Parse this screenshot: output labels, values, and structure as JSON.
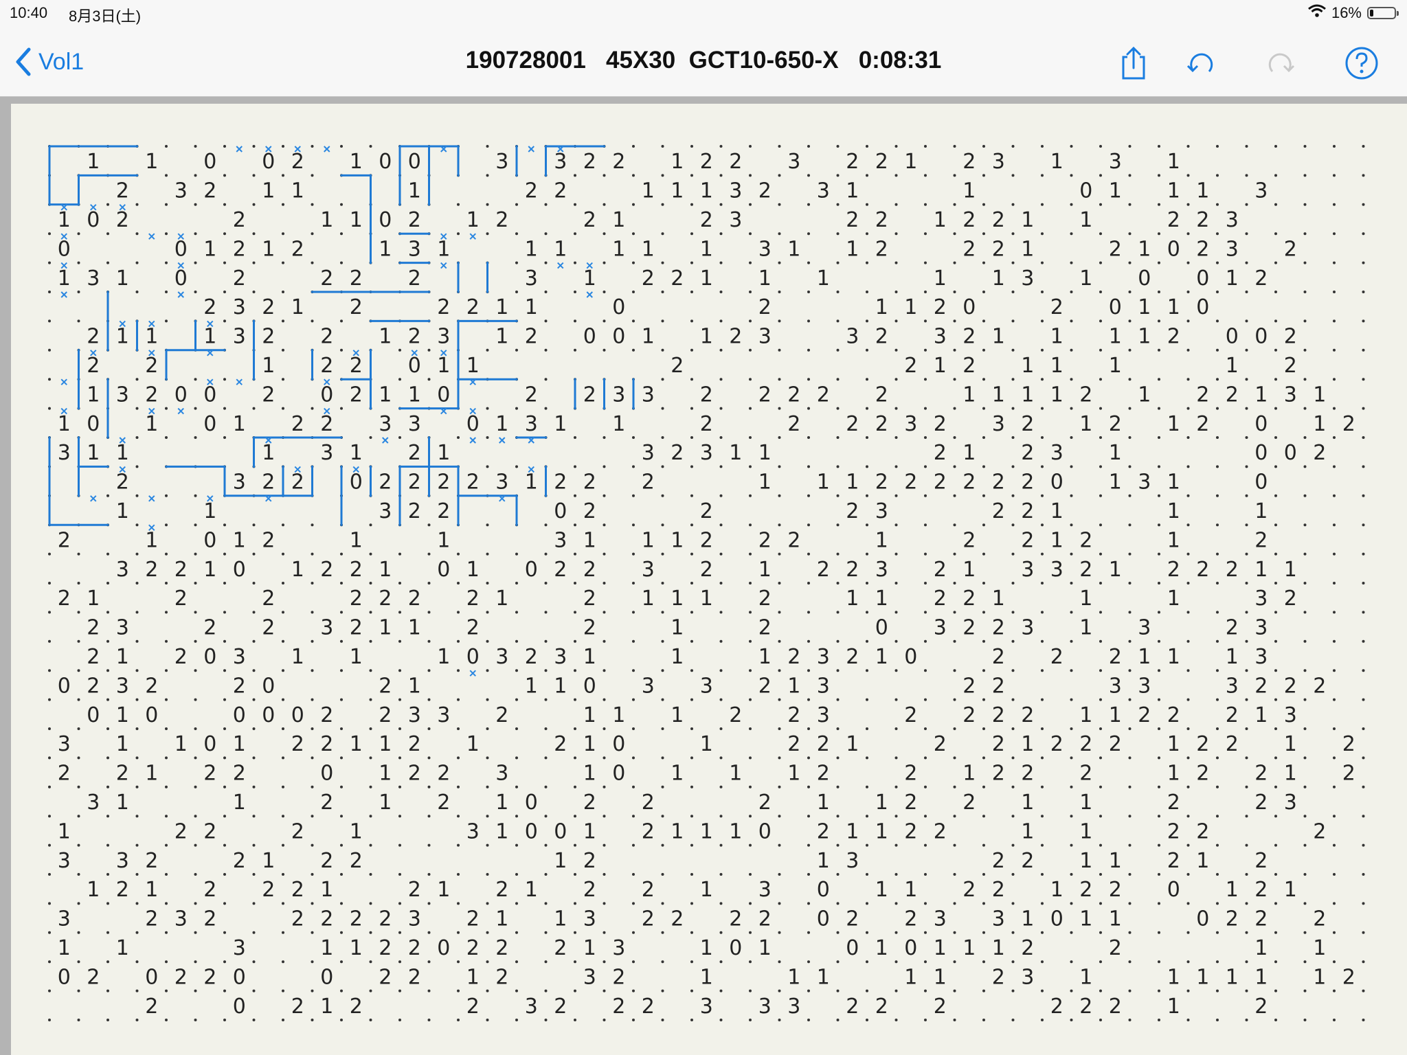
{
  "status_bar": {
    "time": "10:40",
    "date": "8月3日(土)",
    "battery": "16%",
    "battery_level": 0.16
  },
  "nav": {
    "back_label": "Vol1",
    "title": "190728001   45X30  GCT10-650-X   0:08:31",
    "icons": [
      "share-icon",
      "undo-icon",
      "redo-icon",
      "help-icon"
    ]
  },
  "colors": {
    "accent": "#1a7de0",
    "line": "#1f7ad4",
    "board_bg": "#f2f2ea",
    "frame": "#b4b4b4"
  },
  "puzzle": {
    "cols": 45,
    "rows": 30,
    "clues": [
      [
        " ",
        "1",
        " ",
        "1",
        " ",
        "0",
        " ",
        "0",
        "2",
        " ",
        "1",
        "0",
        "0",
        " ",
        " ",
        "3",
        " ",
        "3",
        "2",
        "2",
        " ",
        "1",
        "2",
        "2",
        " ",
        "3",
        " ",
        "2",
        "2",
        "1",
        " ",
        "2",
        "3",
        " ",
        "1",
        " ",
        "3",
        " ",
        "1",
        " ",
        " ",
        " ",
        " ",
        " ",
        " "
      ],
      [
        " ",
        " ",
        "2",
        " ",
        "3",
        "2",
        " ",
        "1",
        "1",
        " ",
        " ",
        " ",
        "1",
        " ",
        " ",
        " ",
        "2",
        "2",
        " ",
        " ",
        "1",
        "1",
        "1",
        "3",
        "2",
        " ",
        "3",
        "1",
        " ",
        " ",
        " ",
        "1",
        " ",
        " ",
        " ",
        "0",
        "1",
        " ",
        "1",
        "1",
        " ",
        "3",
        " ",
        " "
      ],
      [
        "1",
        "0",
        "2",
        " ",
        " ",
        " ",
        "2",
        " ",
        " ",
        "1",
        "1",
        "0",
        "2",
        " ",
        "1",
        "2",
        " ",
        " ",
        "2",
        "1",
        " ",
        " ",
        "2",
        "3",
        " ",
        " ",
        " ",
        "2",
        "2",
        " ",
        "1",
        "2",
        "2",
        "1",
        " ",
        "1",
        " ",
        " ",
        "2",
        "2",
        "3",
        " ",
        " ",
        " "
      ],
      [
        "0",
        " ",
        " ",
        " ",
        "0",
        "1",
        "2",
        "1",
        "2",
        " ",
        " ",
        "1",
        "3",
        "1",
        " ",
        " ",
        "1",
        "1",
        " ",
        "1",
        "1",
        " ",
        "1",
        " ",
        "3",
        "1",
        " ",
        "1",
        "2",
        " ",
        " ",
        "2",
        "2",
        "1",
        " ",
        " ",
        "2",
        "1",
        "0",
        "2",
        "3",
        " ",
        "2"
      ],
      [
        "1",
        "3",
        "1",
        " ",
        "0",
        " ",
        "2",
        " ",
        " ",
        "2",
        "2",
        " ",
        "2",
        " ",
        " ",
        " ",
        "3",
        " ",
        "1",
        " ",
        "2",
        "2",
        "1",
        " ",
        "1",
        " ",
        "1",
        " ",
        " ",
        " ",
        "1",
        " ",
        "1",
        "3",
        " ",
        "1",
        " ",
        "0",
        " ",
        "0",
        "1",
        "2",
        " "
      ],
      [
        " ",
        " ",
        " ",
        " ",
        " ",
        "2",
        "3",
        "2",
        "1",
        " ",
        "2",
        " ",
        " ",
        "2",
        "2",
        "1",
        "1",
        " ",
        " ",
        "0",
        " ",
        " ",
        " ",
        " ",
        "2",
        " ",
        " ",
        " ",
        "1",
        "1",
        "2",
        "0",
        " ",
        " ",
        "2",
        " ",
        "0",
        "1",
        "1",
        "0",
        " ",
        " ",
        " "
      ],
      [
        " ",
        "2",
        "1",
        "1",
        " ",
        "1",
        "3",
        "2",
        " ",
        "2",
        " ",
        "1",
        "2",
        "3",
        " ",
        "1",
        "2",
        " ",
        "0",
        "0",
        "1",
        " ",
        "1",
        "2",
        "3",
        " ",
        " ",
        "3",
        "2",
        " ",
        "3",
        "2",
        "1",
        " ",
        "1",
        " ",
        "1",
        "1",
        "2",
        " ",
        "0",
        "0",
        "2"
      ],
      [
        " ",
        "2",
        " ",
        "2",
        " ",
        " ",
        " ",
        "1",
        " ",
        "2",
        "2",
        " ",
        "0",
        "1",
        "1",
        " ",
        " ",
        " ",
        " ",
        " ",
        " ",
        "2",
        " ",
        " ",
        " ",
        " ",
        " ",
        " ",
        " ",
        "2",
        "1",
        "2",
        " ",
        "1",
        "1",
        " ",
        "1",
        " ",
        " ",
        " ",
        "1",
        " ",
        "2"
      ],
      [
        " ",
        "1",
        "3",
        "2",
        "0",
        "0",
        " ",
        "2",
        " ",
        "0",
        "2",
        "1",
        "1",
        "0",
        " ",
        " ",
        "2",
        " ",
        "2",
        "3",
        "3",
        " ",
        "2",
        " ",
        "2",
        "2",
        "2",
        " ",
        "2",
        " ",
        " ",
        "1",
        "1",
        "1",
        "1",
        "2",
        " ",
        "1",
        " ",
        "2",
        "2",
        "1",
        "3",
        "1"
      ],
      [
        "1",
        "0",
        " ",
        "1",
        " ",
        "0",
        "1",
        " ",
        "2",
        "2",
        " ",
        "3",
        "3",
        " ",
        "0",
        "1",
        "3",
        "1",
        " ",
        "1",
        " ",
        " ",
        "2",
        " ",
        " ",
        "2",
        " ",
        "2",
        "2",
        "3",
        "2",
        " ",
        "3",
        "2",
        " ",
        "1",
        "2",
        " ",
        "1",
        "2",
        " ",
        "0",
        " ",
        "1",
        "2"
      ],
      [
        "3",
        "1",
        "1",
        " ",
        " ",
        " ",
        " ",
        "1",
        " ",
        "3",
        "1",
        " ",
        "2",
        "1",
        " ",
        " ",
        " ",
        " ",
        " ",
        " ",
        "3",
        "2",
        "3",
        "1",
        "1",
        " ",
        " ",
        " ",
        " ",
        " ",
        "2",
        "1",
        " ",
        "2",
        "3",
        " ",
        "1",
        " ",
        " ",
        " ",
        " ",
        "0",
        "0",
        "2"
      ],
      [
        " ",
        " ",
        "2",
        " ",
        " ",
        " ",
        "3",
        "2",
        "2",
        " ",
        "0",
        "2",
        "2",
        "2",
        "2",
        "3",
        "1",
        "2",
        "2",
        " ",
        "2",
        " ",
        " ",
        " ",
        "1",
        " ",
        "1",
        "1",
        "2",
        "2",
        "2",
        "2",
        "2",
        "2",
        "0",
        " ",
        "1",
        "3",
        "1",
        " ",
        " ",
        "0",
        " ",
        " "
      ],
      [
        " ",
        " ",
        "1",
        " ",
        " ",
        "1",
        " ",
        " ",
        " ",
        " ",
        " ",
        "3",
        "2",
        "2",
        " ",
        " ",
        " ",
        "0",
        "2",
        " ",
        " ",
        " ",
        "2",
        " ",
        " ",
        " ",
        " ",
        "2",
        "3",
        " ",
        " ",
        " ",
        "2",
        "2",
        "1",
        " ",
        " ",
        " ",
        "1",
        " ",
        " ",
        "1",
        " ",
        " "
      ],
      [
        "2",
        " ",
        " ",
        "1",
        " ",
        "0",
        "1",
        "2",
        " ",
        " ",
        "1",
        " ",
        " ",
        "1",
        " ",
        " ",
        " ",
        "3",
        "1",
        " ",
        "1",
        "1",
        "2",
        " ",
        "2",
        "2",
        " ",
        " ",
        "1",
        " ",
        " ",
        "2",
        " ",
        "2",
        "1",
        "2",
        " ",
        " ",
        "1",
        " ",
        " ",
        "2"
      ],
      [
        " ",
        " ",
        "3",
        "2",
        "2",
        "1",
        "0",
        " ",
        "1",
        "2",
        "2",
        "1",
        " ",
        "0",
        "1",
        " ",
        "0",
        "2",
        "2",
        " ",
        "3",
        " ",
        "2",
        " ",
        "1",
        " ",
        "2",
        "2",
        "3",
        " ",
        "2",
        "1",
        " ",
        "3",
        "3",
        "2",
        "1",
        " ",
        "2",
        "2",
        "2",
        "1",
        "1",
        " "
      ],
      [
        "2",
        "1",
        " ",
        " ",
        "2",
        " ",
        " ",
        "2",
        " ",
        " ",
        "2",
        "2",
        "2",
        " ",
        "2",
        "1",
        " ",
        " ",
        "2",
        " ",
        "1",
        "1",
        "1",
        " ",
        "2",
        " ",
        " ",
        "1",
        "1",
        " ",
        "2",
        "2",
        "1",
        " ",
        " ",
        "1",
        " ",
        " ",
        "1",
        " ",
        " ",
        "3",
        "2",
        " "
      ],
      [
        " ",
        "2",
        "3",
        " ",
        " ",
        "2",
        " ",
        "2",
        " ",
        "3",
        "2",
        "1",
        "1",
        " ",
        "2",
        " ",
        " ",
        " ",
        "2",
        " ",
        " ",
        "1",
        " ",
        " ",
        "2",
        " ",
        " ",
        " ",
        "0",
        " ",
        "3",
        "2",
        "2",
        "3",
        " ",
        "1",
        " ",
        "3",
        " ",
        " ",
        "2",
        "3",
        " "
      ],
      [
        " ",
        "2",
        "1",
        " ",
        "2",
        "0",
        "3",
        " ",
        "1",
        " ",
        "1",
        " ",
        " ",
        "1",
        "0",
        "3",
        "2",
        "3",
        "1",
        " ",
        " ",
        "1",
        " ",
        " ",
        "1",
        "2",
        "3",
        "2",
        "1",
        "0",
        " ",
        " ",
        "2",
        " ",
        "2",
        " ",
        "2",
        "1",
        "1",
        " ",
        "1",
        "3",
        " "
      ],
      [
        "0",
        "2",
        "3",
        "2",
        " ",
        " ",
        "2",
        "0",
        " ",
        " ",
        " ",
        "2",
        "1",
        " ",
        " ",
        " ",
        "1",
        "1",
        "0",
        " ",
        "3",
        " ",
        "3",
        " ",
        "2",
        "1",
        "3",
        " ",
        " ",
        " ",
        " ",
        "2",
        "2",
        " ",
        " ",
        " ",
        "3",
        "3",
        " ",
        " ",
        "3",
        "2",
        "2",
        "2"
      ],
      [
        " ",
        "0",
        "1",
        "0",
        " ",
        " ",
        "0",
        "0",
        "0",
        "2",
        " ",
        "2",
        "3",
        "3",
        " ",
        "2",
        " ",
        " ",
        "1",
        "1",
        " ",
        "1",
        " ",
        "2",
        " ",
        "2",
        "3",
        " ",
        " ",
        "2",
        " ",
        "2",
        "2",
        "2",
        " ",
        "1",
        "1",
        "2",
        "2",
        " ",
        "2",
        "1",
        "3",
        " "
      ],
      [
        "3",
        " ",
        "1",
        " ",
        "1",
        "0",
        "1",
        " ",
        "2",
        "2",
        "1",
        "1",
        "2",
        " ",
        "1",
        " ",
        " ",
        "2",
        "1",
        "0",
        " ",
        " ",
        "1",
        " ",
        " ",
        "2",
        "2",
        "1",
        " ",
        " ",
        "2",
        " ",
        "2",
        "1",
        "2",
        "2",
        "2",
        " ",
        "1",
        "2",
        "2",
        " ",
        "1",
        " ",
        "2"
      ],
      [
        "2",
        " ",
        "2",
        "1",
        " ",
        "2",
        "2",
        " ",
        " ",
        "0",
        " ",
        "1",
        "2",
        "2",
        " ",
        "3",
        " ",
        " ",
        "1",
        "0",
        " ",
        "1",
        " ",
        "1",
        " ",
        "1",
        "2",
        " ",
        " ",
        "2",
        " ",
        "1",
        "2",
        "2",
        " ",
        "2",
        " ",
        " ",
        "1",
        "2",
        " ",
        "2",
        "1",
        " ",
        "2"
      ],
      [
        " ",
        "3",
        "1",
        " ",
        " ",
        " ",
        "1",
        " ",
        " ",
        "2",
        " ",
        "1",
        " ",
        "2",
        " ",
        "1",
        "0",
        " ",
        "2",
        " ",
        "2",
        " ",
        " ",
        " ",
        "2",
        " ",
        "1",
        " ",
        "1",
        "2",
        " ",
        "2",
        " ",
        "1",
        " ",
        "1",
        " ",
        " ",
        "2",
        " ",
        " ",
        "2",
        "3",
        " "
      ],
      [
        "1",
        " ",
        " ",
        " ",
        "2",
        "2",
        " ",
        " ",
        "2",
        " ",
        "1",
        " ",
        " ",
        " ",
        "3",
        "1",
        "0",
        "0",
        "1",
        " ",
        "2",
        "1",
        "1",
        "1",
        "0",
        " ",
        "2",
        "1",
        "1",
        "2",
        "2",
        " ",
        " ",
        "1",
        " ",
        "1",
        " ",
        " ",
        "2",
        "2",
        " ",
        " ",
        " ",
        "2"
      ],
      [
        "3",
        " ",
        "3",
        "2",
        " ",
        " ",
        "2",
        "1",
        " ",
        "2",
        "2",
        " ",
        " ",
        " ",
        " ",
        " ",
        " ",
        "1",
        "2",
        " ",
        " ",
        " ",
        " ",
        " ",
        " ",
        " ",
        "1",
        "3",
        " ",
        " ",
        " ",
        " ",
        "2",
        "2",
        " ",
        "1",
        "1",
        " ",
        "2",
        "1",
        " ",
        "2"
      ],
      [
        " ",
        "1",
        "2",
        "1",
        " ",
        "2",
        " ",
        "2",
        "2",
        "1",
        " ",
        " ",
        "2",
        "1",
        " ",
        "2",
        "1",
        " ",
        "2",
        " ",
        "2",
        " ",
        "1",
        " ",
        "3",
        " ",
        "0",
        " ",
        "1",
        "1",
        " ",
        "2",
        "2",
        " ",
        "1",
        "2",
        "2",
        " ",
        "0",
        " ",
        "1",
        "2",
        "1",
        " "
      ],
      [
        "3",
        " ",
        " ",
        "2",
        "3",
        "2",
        " ",
        " ",
        "2",
        "2",
        "2",
        "2",
        "3",
        " ",
        "2",
        "1",
        " ",
        "1",
        "3",
        " ",
        "2",
        "2",
        " ",
        "2",
        "2",
        " ",
        "0",
        "2",
        " ",
        "2",
        "3",
        " ",
        "3",
        "1",
        "0",
        "1",
        "1",
        " ",
        " ",
        "0",
        "2",
        "2",
        " ",
        "2"
      ],
      [
        "1",
        " ",
        "1",
        " ",
        " ",
        " ",
        "3",
        " ",
        " ",
        "1",
        "1",
        "2",
        "2",
        "0",
        "2",
        "2",
        " ",
        "2",
        "1",
        "3",
        " ",
        " ",
        "1",
        "0",
        "1",
        " ",
        " ",
        "0",
        "1",
        "0",
        "1",
        "1",
        "1",
        "2",
        " ",
        " ",
        "2",
        " ",
        " ",
        " ",
        " ",
        "1",
        " ",
        "1"
      ],
      [
        "0",
        "2",
        " ",
        "0",
        "2",
        "2",
        "0",
        " ",
        " ",
        "0",
        " ",
        "2",
        "2",
        " ",
        "1",
        "2",
        " ",
        " ",
        "3",
        "2",
        " ",
        " ",
        "1",
        " ",
        " ",
        "1",
        "1",
        " ",
        " ",
        "1",
        "1",
        " ",
        "2",
        "3",
        " ",
        "1",
        " ",
        " ",
        "1",
        "1",
        "1",
        "1",
        " ",
        "1",
        "2"
      ],
      [
        " ",
        " ",
        " ",
        "2",
        " ",
        " ",
        "0",
        " ",
        "2",
        "1",
        "2",
        " ",
        " ",
        " ",
        "2",
        " ",
        "3",
        "2",
        " ",
        "2",
        "2",
        " ",
        "3",
        " ",
        "3",
        "3",
        " ",
        "2",
        "2",
        " ",
        "2",
        " ",
        " ",
        " ",
        "2",
        "2",
        "2",
        " ",
        "1",
        " ",
        " ",
        "2",
        " ",
        " "
      ]
    ]
  }
}
